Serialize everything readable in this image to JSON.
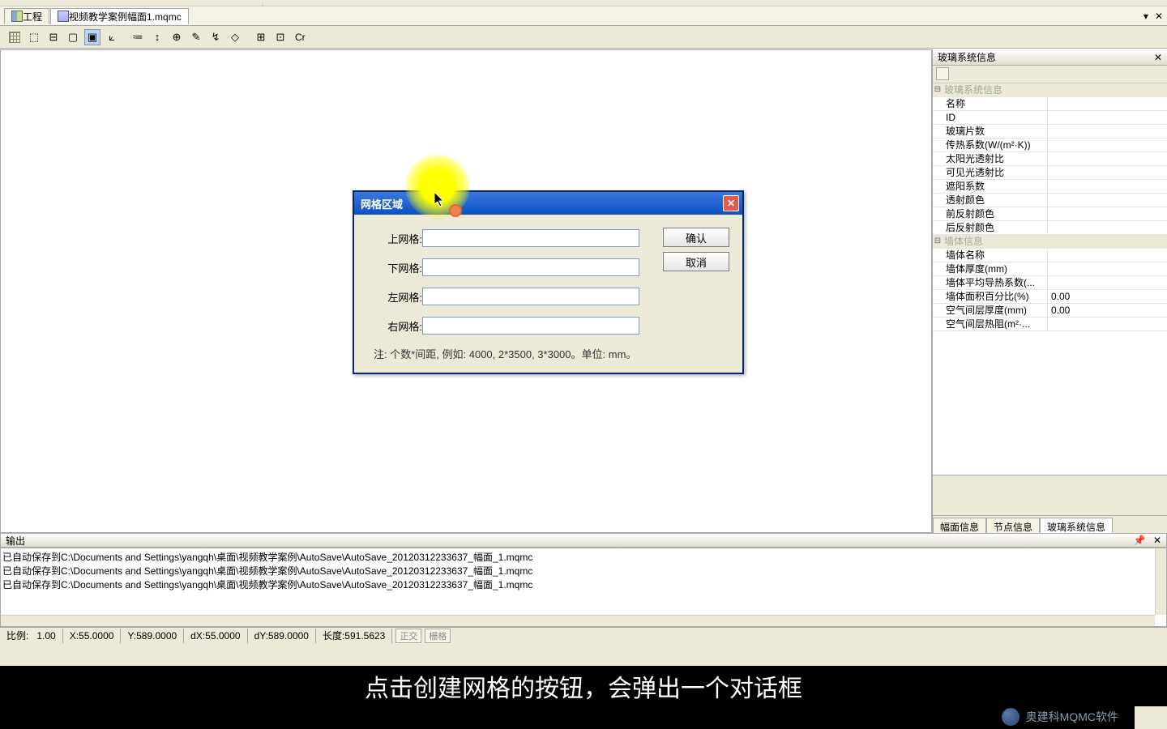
{
  "tabs": {
    "project": "工程",
    "document": "视频教学案例幅面1.mqmc"
  },
  "toolbar_text": "Cr",
  "side_panel": {
    "title": "玻璃系统信息",
    "group1": "玻璃系统信息",
    "props1": [
      {
        "label": "名称",
        "value": ""
      },
      {
        "label": "ID",
        "value": ""
      },
      {
        "label": "玻璃片数",
        "value": ""
      },
      {
        "label": "传热系数(W/(m²·K))",
        "value": ""
      },
      {
        "label": "太阳光透射比",
        "value": ""
      },
      {
        "label": "可见光透射比",
        "value": ""
      },
      {
        "label": "遮阳系数",
        "value": ""
      },
      {
        "label": "透射颜色",
        "value": ""
      },
      {
        "label": "前反射颜色",
        "value": ""
      },
      {
        "label": "后反射颜色",
        "value": ""
      }
    ],
    "group2": "墙体信息",
    "props2": [
      {
        "label": "墙体名称",
        "value": ""
      },
      {
        "label": "墙体厚度(mm)",
        "value": ""
      },
      {
        "label": "墙体平均导热系数(...",
        "value": ""
      },
      {
        "label": "墙体面积百分比(%)",
        "value": "0.00"
      },
      {
        "label": "空气间层厚度(mm)",
        "value": "0.00"
      },
      {
        "label": "空气间层热阻(m²·...",
        "value": ""
      }
    ],
    "tabs": [
      "幅面信息",
      "节点信息",
      "玻璃系统信息"
    ]
  },
  "output": {
    "title": "输出",
    "lines": [
      "已自动保存到C:\\Documents and Settings\\yangqh\\桌面\\视频教学案例\\AutoSave\\AutoSave_20120312233637_幅面_1.mqmc",
      "已自动保存到C:\\Documents and Settings\\yangqh\\桌面\\视频教学案例\\AutoSave\\AutoSave_20120312233637_幅面_1.mqmc",
      "已自动保存到C:\\Documents and Settings\\yangqh\\桌面\\视频教学案例\\AutoSave\\AutoSave_20120312233637_幅面_1.mqmc"
    ]
  },
  "status": {
    "scale_label": "比例:",
    "scale": "1.00",
    "x": "X:55.0000",
    "y": "Y:589.0000",
    "dx": "dX:55.0000",
    "dy": "dY:589.0000",
    "len": "长度:591.5623",
    "btn1": "正交",
    "btn2": "栅格"
  },
  "dialog": {
    "title": "网格区域",
    "top": "上网格:",
    "bottom": "下网格:",
    "left": "左网格:",
    "right": "右网格:",
    "ok": "确认",
    "cancel": "取消",
    "note": "注: 个数*间距, 例如: 4000, 2*3500, 3*3000。单位: mm。"
  },
  "subtitle": "点击创建网格的按钮，会弹出一个对话框",
  "watermark": "奥建科MQMC软件"
}
